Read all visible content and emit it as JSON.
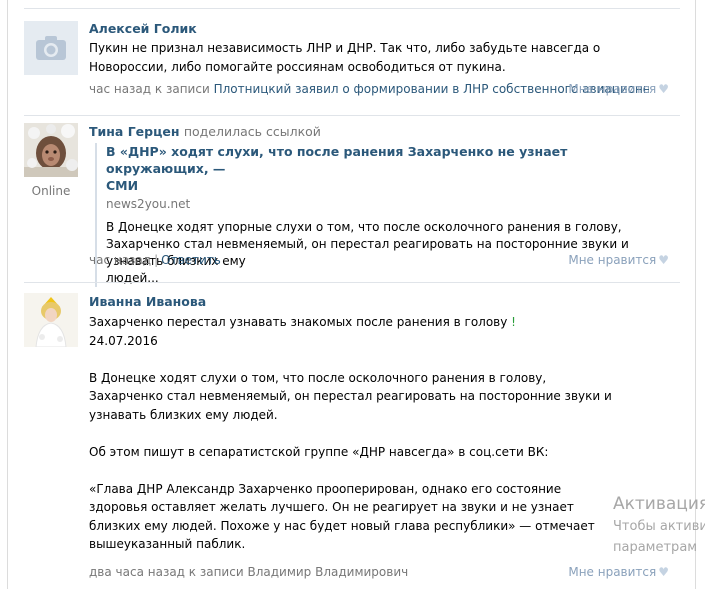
{
  "posts": [
    {
      "author": "Алексей Голик",
      "lines": [
        "Пукин не признал независимость ЛНР и ДНР. Так что, либо забудьте навсегда о",
        "Новороссии, либо помогайте россиянам освободиться от пукина."
      ],
      "meta_time": "час назад к записи",
      "meta_link": "Плотницкий заявил о формировании в ЛНР собственного авиационного звена",
      "like_label": "Мне нравится",
      "avatar_icon": "camera-icon"
    },
    {
      "author": "Тина Герцен",
      "author_note": "поделилась ссылкой",
      "online_label": "Online",
      "shared_link": {
        "title_line1": "В «ДНР» ходят слухи, что после ранения Захарченко не узнает окружающих, —",
        "title_line2": "СМИ",
        "domain": "news2you.net",
        "desc_lines": [
          "В Донецке ходят упорные слухи о том, что после осколочного ранения в голову,",
          "Захарченко стал невменяемый, он перестал реагировать на посторонние звуки и узнавать близких ему",
          "людей..."
        ]
      },
      "meta_time": "час назад",
      "reply_label": "Ответить",
      "like_label": "Мне нравится"
    },
    {
      "author": "Иванна Иванова",
      "lines": [
        "Захарченко перестал узнавать знакомых после ранения в голову",
        "24.07.2016",
        "",
        "В Донецке ходят слухи о том, что после осколочного ранения в голову,",
        "Захарченко стал невменяемый, он перестал реагировать на посторонние звуки и",
        "узнавать близких ему людей.",
        "",
        "Об этом пишут в сепаратистской группе «ДНР навсегда» в соц.сети ВК:",
        "",
        "«Глава ДНР Александр Захарченко прооперирован, однако его состояние",
        "здоровья оставляет желать лучшего. Он не реагирует на звуки и не узнает",
        "близких ему людей. Похоже у нас будет новый глава республики» — отмечает",
        "вышеуказанный паблик."
      ],
      "exclaim": "!",
      "meta_time": "два часа назад к записи",
      "meta_link": "Владимир Владимирович",
      "like_label": "Мне нравится"
    }
  ],
  "watermark": {
    "line1": "Активация",
    "line2": "Чтобы активи",
    "line3": "параметрам"
  },
  "colors": {
    "link": "#2b587a",
    "meta": "#777777",
    "like": "#8aa1bb",
    "exclaim": "#2a9d3a"
  }
}
